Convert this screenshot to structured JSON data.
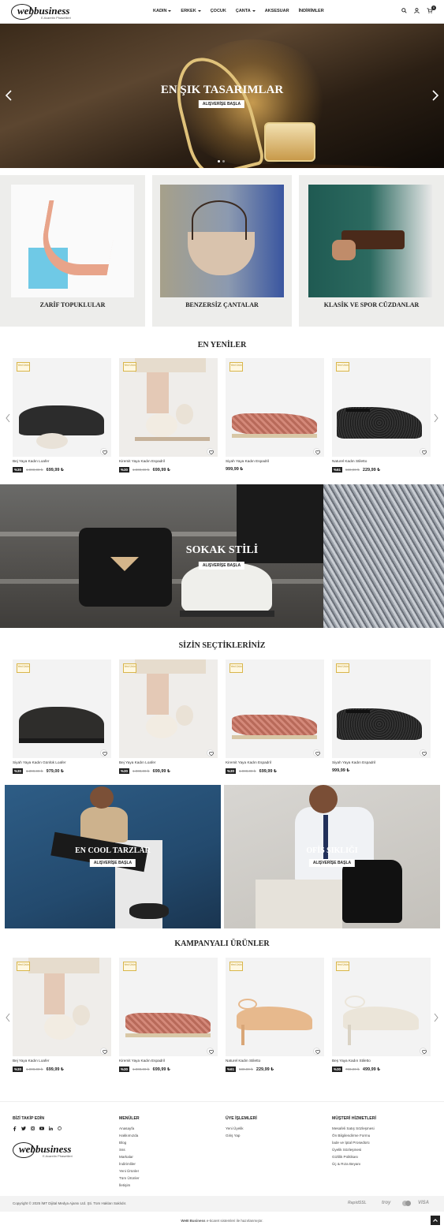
{
  "header": {
    "logo_text": "webbusiness",
    "logo_sub": "E-ticaretin Phasetileri",
    "nav": [
      {
        "label": "KADIN",
        "dropdown": true
      },
      {
        "label": "ERKEK",
        "dropdown": true
      },
      {
        "label": "ÇOCUK",
        "dropdown": false
      },
      {
        "label": "ÇANTA",
        "dropdown": true
      },
      {
        "label": "AKSESUAR",
        "dropdown": false
      },
      {
        "label": "İNDİRİMLER",
        "dropdown": false
      }
    ],
    "cart_count": "0",
    "icons": [
      "search-icon",
      "user-icon",
      "cart-icon"
    ]
  },
  "hero": {
    "title": "EN ŞIK TASARIMLAR",
    "button": "ALIŞVERİŞE BAŞLA"
  },
  "categories": [
    {
      "label": "ZARİF TOPUKLULAR"
    },
    {
      "label": "BENZERSİZ ÇANTALAR"
    },
    {
      "label": "KLASİK VE SPOR CÜZDANLAR"
    }
  ],
  "badge_text": "Yeni Ürün",
  "sections": {
    "new": {
      "title": "EN YENİLER",
      "products": [
        {
          "name": "Bej Yaya Kadın Loafer",
          "discount": "%30",
          "old": "1.000,00 ₺",
          "price": "699,99 ₺"
        },
        {
          "name": "Kiremit Yaya Kadın Espadril",
          "discount": "%30",
          "old": "1.000,00 ₺",
          "price": "699,99 ₺"
        },
        {
          "name": "Siyah Yaya Kadın Espadril",
          "discount": "",
          "old": "",
          "price": "999,99 ₺"
        },
        {
          "name": "Naturel Kadın Stiletto",
          "discount": "%61",
          "old": "580,00 ₺",
          "price": "229,99 ₺"
        }
      ]
    },
    "street": {
      "title": "SOKAK STİLİ",
      "button": "ALIŞVERİŞE BAŞLA"
    },
    "picks": {
      "title": "SİZİN SEÇTİKLERİNİZ",
      "products": [
        {
          "name": "Siyah Yaya Kadın Günlük Loafer",
          "discount": "%30",
          "old": "1.399,99 ₺",
          "price": "979,00 ₺"
        },
        {
          "name": "Bej Yaya Kadın Loafer",
          "discount": "%30",
          "old": "1.000,00 ₺",
          "price": "699,99 ₺"
        },
        {
          "name": "Kiremit Yaya Kadın Espadril",
          "discount": "%30",
          "old": "1.000,00 ₺",
          "price": "699,99 ₺"
        },
        {
          "name": "Siyah Yaya Kadın Espadril",
          "discount": "",
          "old": "",
          "price": "999,99 ₺"
        }
      ]
    },
    "cool": {
      "title": "EN COOL TARZLAR",
      "button": "ALIŞVERİŞE BAŞLA"
    },
    "office": {
      "title": "OFİS ŞIKLIĞI",
      "button": "ALIŞVERİŞE BAŞLA"
    },
    "campaign": {
      "title": "KAMPANYALI ÜRÜNLER",
      "products": [
        {
          "name": "Bej Yaya Kadın Loafer",
          "discount": "%30",
          "old": "1.000,00 ₺",
          "price": "699,99 ₺"
        },
        {
          "name": "Kiremit Yaya Kadın Espadril",
          "discount": "%30",
          "old": "1.000,00 ₺",
          "price": "699,99 ₺"
        },
        {
          "name": "Naturel Kadın Stiletto",
          "discount": "%61",
          "old": "580,00 ₺",
          "price": "229,99 ₺"
        },
        {
          "name": "Beş Yaya Kadın Stiletto",
          "discount": "%30",
          "old": "700,00 ₺",
          "price": "499,99 ₺"
        }
      ]
    }
  },
  "footer": {
    "follow_title": "BİZİ TAKİP EDİN",
    "menus_title": "MENÜLER",
    "menus": [
      "Anasayfa",
      "Hakkımızda",
      "Blog",
      "Sss",
      "Markalar",
      "İndirimliler",
      "Yeni Ürünler",
      "Tüm Ürünler",
      "İletişim"
    ],
    "member_title": "ÜYE İŞLEMLERİ",
    "member": [
      "Yeni Üyelik",
      "Giriş Yap"
    ],
    "service_title": "MÜŞTERİ HİZMETLERİ",
    "service": [
      "Mesafeli Satış Sözleşmesi",
      "Ön Bilgilendirme Formu",
      "İade ve İptal Prosedürü",
      "Üyelik Sözleşmesi",
      "Gizlilik Politikası",
      "Üç & Rıza Beyanı"
    ],
    "copyright": "Copyright © 2025 İMT Dijital Medya Ajansı Ltd. Şti. Tüm Hakları Saklıdır.",
    "payments": [
      "RapidSSL",
      "troy",
      "mastercard",
      "VISA"
    ],
    "bottom_brand": "WeB Business",
    "bottom_text": "e-ticaret sistemleri ile hazırlanmıştır."
  }
}
